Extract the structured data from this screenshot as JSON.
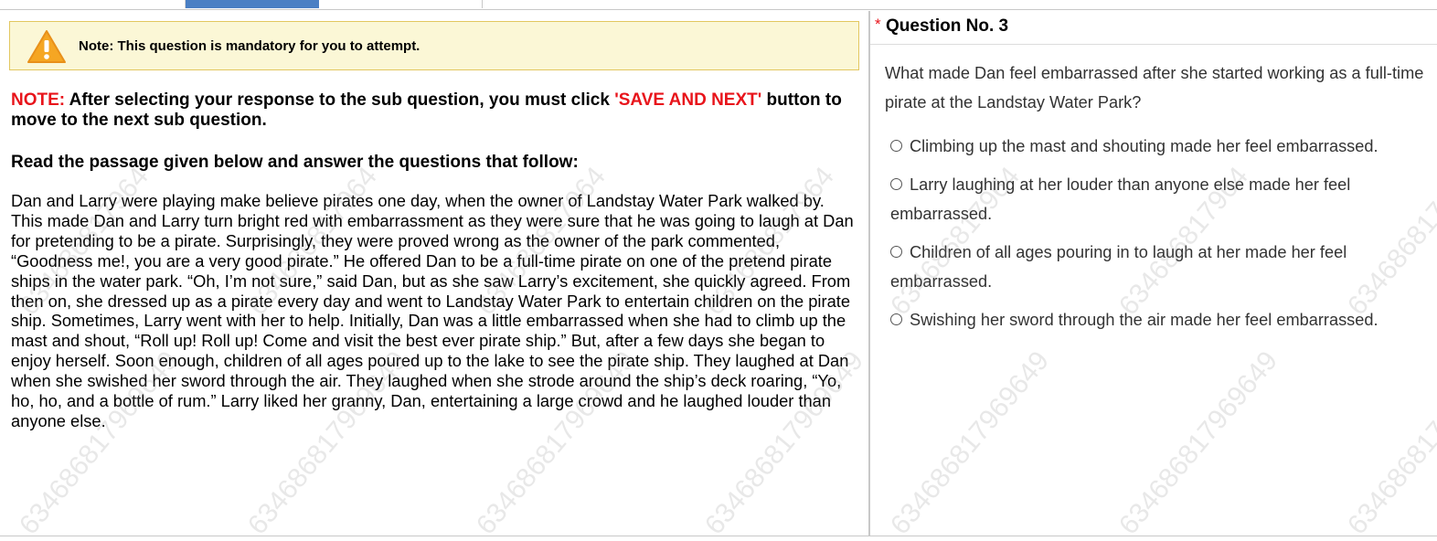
{
  "note": {
    "text": "Note: This question is mandatory for you to attempt."
  },
  "instruction": {
    "prefix": "NOTE:",
    "part1": " After selecting your response to the sub question, you must click ",
    "button_ref": "'SAVE AND NEXT'",
    "part2": " button to move to the next sub question."
  },
  "passage_heading": "Read the passage given below and answer the questions that follow:",
  "passage": "Dan and Larry were playing make believe pirates one day, when the owner of Landstay Water Park walked by. This made Dan and Larry turn bright red with embarrassment as they were sure that he was going to laugh at Dan for pretending to be a pirate. Surprisingly, they were proved wrong as the owner of the park commented, “Goodness me!, you are a very good pirate.” He offered Dan to be a full-time pirate on one of the pretend pirate ships in the water park. “Oh, I’m not sure,” said Dan, but as she saw Larry’s excitement, she quickly agreed. From then on, she dressed up as a pirate every day and went to Landstay Water Park to entertain children on the pirate ship. Sometimes, Larry went with her to help. Initially, Dan was a little embarrassed when she had to climb up the mast and shout, “Roll up! Roll up! Come and visit the best ever pirate ship.” But, after a few days she began to enjoy herself. Soon enough, children of all ages poured up to the lake to see the pirate ship. They laughed at Dan when she swished her sword through the air. They laughed when she strode around the ship’s deck roaring, “Yo, ho, ho, and a bottle of rum.” Larry liked her granny, Dan, entertaining a large crowd and he laughed louder than anyone else.",
  "question": {
    "required_marker": "*",
    "title": "Question No. 3",
    "text": "What made Dan feel embarrassed after she started working as a full-time pirate at the Landstay Water Park?",
    "options": [
      "Climbing up the mast and shouting made her feel embarrassed.",
      "Larry laughing at her louder than anyone else made her feel embarrassed.",
      "Children of all ages pouring in to laugh at her made her feel embarrassed.",
      "Swishing her sword through the air made her feel embarrassed."
    ]
  },
  "watermark": "634686817964",
  "watermark_full": "634686817969649",
  "colors": {
    "accent_red": "#e8141b",
    "tab_active": "#4a7fc4",
    "note_bg": "#fbf7d6",
    "note_border": "#e2c760"
  }
}
